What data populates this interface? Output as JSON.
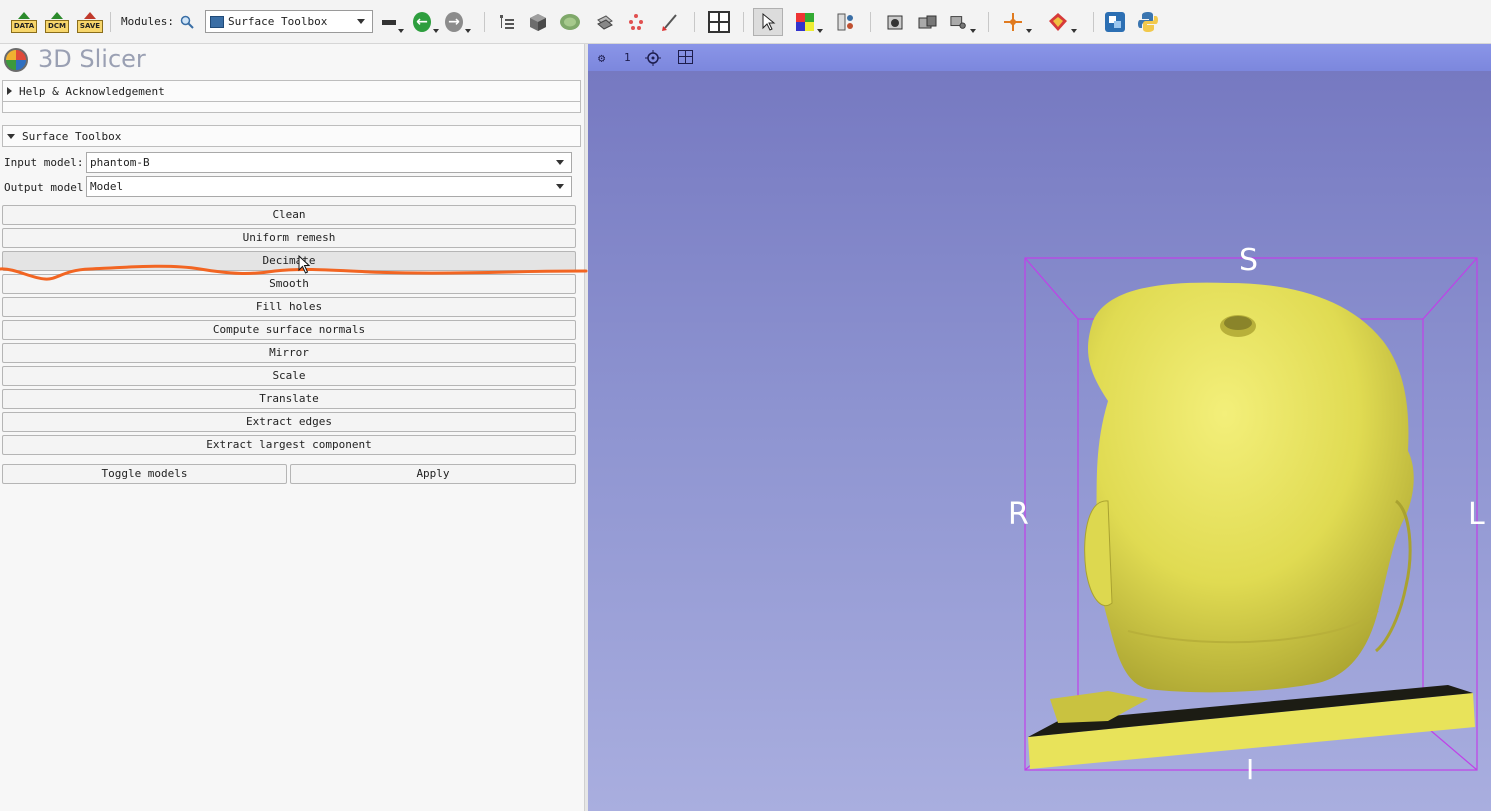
{
  "toolbar": {
    "file_buttons": [
      {
        "label": "DATA",
        "icon": "load-data-icon"
      },
      {
        "label": "DCM",
        "icon": "dicom-icon"
      },
      {
        "label": "SAVE",
        "icon": "save-icon"
      }
    ],
    "modules_label": "Modules:",
    "module_select_value": "Surface Toolbox"
  },
  "app": {
    "title": "3D Slicer"
  },
  "panel": {
    "help_section": "Help & Acknowledgement",
    "surface_section": "Surface Toolbox",
    "input_model_label": "Input model:",
    "input_model_value": "phantom-B",
    "output_model_label": "Output model:",
    "output_model_value": "Model",
    "operations": [
      "Clean",
      "Uniform remesh",
      "Decimate",
      "Smooth",
      "Fill holes",
      "Compute surface normals",
      "Mirror",
      "Scale",
      "Translate",
      "Extract edges",
      "Extract largest component"
    ],
    "toggle_models_label": "Toggle models",
    "apply_label": "Apply"
  },
  "view": {
    "view_number": "1",
    "orientation": {
      "superior": "S",
      "right": "R",
      "left": "L",
      "inferior": "I"
    },
    "background_top": "#7679c1",
    "background_bottom": "#a9aedf",
    "model_color": "#e8e35a",
    "bounding_box_color": "#c040e8"
  },
  "annotation": {
    "stroke_color": "#f26522"
  }
}
